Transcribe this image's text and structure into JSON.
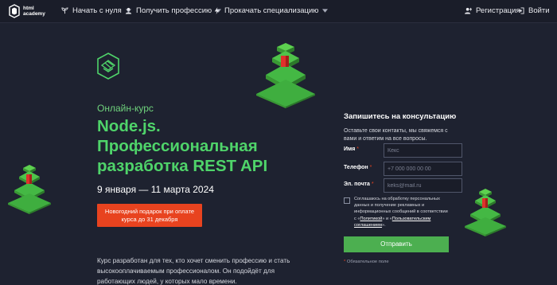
{
  "header": {
    "logo_text_1": "html",
    "logo_text_2": "academy",
    "nav": [
      {
        "label": "Начать с нуля",
        "icon": "sprout-icon"
      },
      {
        "label": "Получить профессию",
        "icon": "person-icon"
      },
      {
        "label": "Прокачать специализацию",
        "icon": "bolt-icon"
      }
    ],
    "register_label": "Регистрация",
    "login_label": "Войти"
  },
  "hero": {
    "kicker": "Онлайн-курс",
    "title": "Node.js. Профессиональная разработка REST API",
    "dates": "9 января — 11 марта 2024",
    "promo_button": "Новогодний подарок при оплате курса до 31 декабря",
    "description": "Курс разработан для тех, кто хочет сменить профессию и стать высокооплачиваемым профессионалом. Он подойдёт для работающих людей, у которых мало времени."
  },
  "form": {
    "title": "Запишитесь на консультацию",
    "subtitle": "Оставьте свои контакты, мы свяжемся с вами и ответим на все вопросы.",
    "fields": [
      {
        "label": "Имя",
        "placeholder": "Кекс"
      },
      {
        "label": "Телефон",
        "placeholder": "+7 000 000 00 00"
      },
      {
        "label": "Эл. почта",
        "placeholder": "keks@mail.ru"
      }
    ],
    "required_mark": "*",
    "consent_text_1": "Соглашаюсь на обработку персональных данных и получение рекламных и информационных сообщений в соответствии с «",
    "consent_link_1": "Политикой",
    "consent_text_2": "» и «",
    "consent_link_2": "Пользовательским соглашением",
    "consent_text_3": "».",
    "submit_label": "Отправить",
    "note": "Обязательное поле"
  },
  "colors": {
    "background": "#1e2230",
    "accent_green": "#4fd46a",
    "promo_orange": "#e8431f",
    "button_green": "#4caf50"
  }
}
